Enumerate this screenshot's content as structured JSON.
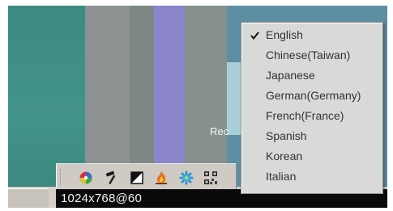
{
  "desktop": {
    "label": "Rec"
  },
  "language_menu": {
    "items": [
      {
        "label": "English",
        "checked": true
      },
      {
        "label": "Chinese(Taiwan)",
        "checked": false
      },
      {
        "label": "Japanese",
        "checked": false
      },
      {
        "label": "German(Germany)",
        "checked": false
      },
      {
        "label": "French(France)",
        "checked": false
      },
      {
        "label": "Spanish",
        "checked": false
      },
      {
        "label": "Korean",
        "checked": false
      },
      {
        "label": "Italian",
        "checked": false
      }
    ]
  },
  "toolbar": {
    "icons": [
      "color-wheel-icon",
      "hammer-icon",
      "contrast-icon",
      "flame-icon",
      "gear-icon",
      "qr-grid-icon"
    ]
  },
  "status": {
    "resolution": "1024x768@60"
  }
}
